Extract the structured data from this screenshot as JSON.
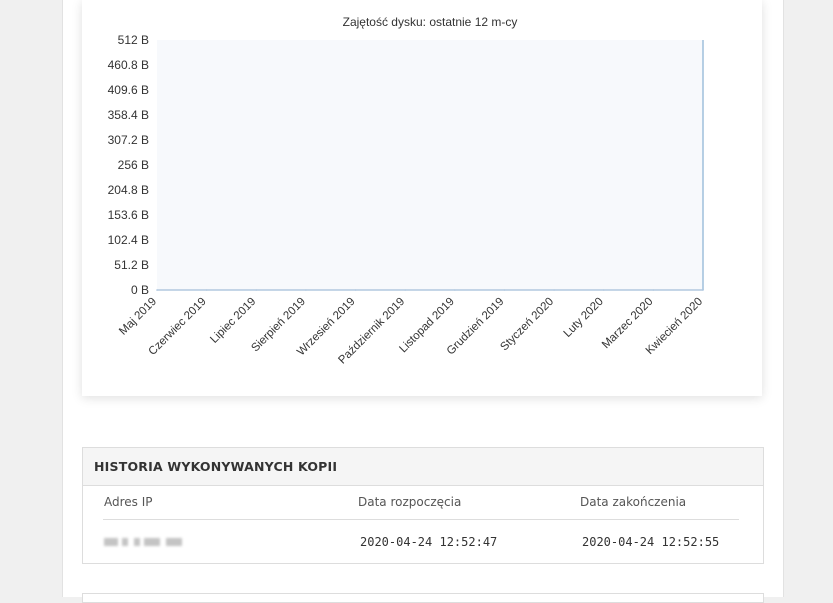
{
  "chart_data": {
    "type": "area",
    "title": "Zajętość dysku: ostatnie 12 m-cy",
    "xlabel": "",
    "ylabel": "",
    "categories": [
      "Maj 2019",
      "Czerwiec 2019",
      "Lipiec 2019",
      "Sierpień 2019",
      "Wrzesień 2019",
      "Październik 2019",
      "Listopad 2019",
      "Grudzień 2019",
      "Styczeń 2020",
      "Luty 2020",
      "Marzec 2020",
      "Kwiecień 2020"
    ],
    "series": [
      {
        "values": [
          0,
          0,
          0,
          0,
          0,
          0,
          0,
          0,
          0,
          0,
          0,
          0
        ],
        "color": "#a7c4de"
      }
    ],
    "yticks": [
      "0 B",
      "51.2 B",
      "102.4 B",
      "153.6 B",
      "204.8 B",
      "256 B",
      "307.2 B",
      "358.4 B",
      "409.6 B",
      "460.8 B",
      "512 B"
    ],
    "ylim": [
      0,
      512
    ],
    "grid": false,
    "plot_background": "#f7f9fc",
    "legend": "none"
  },
  "history": {
    "title": "HISTORIA WYKONYWANYCH KOPII",
    "columns": {
      "ip": "Adres IP",
      "start": "Data rozpoczęcia",
      "end": "Data zakończenia"
    },
    "rows": [
      {
        "start": "2020-04-24 12:52:47",
        "end": "2020-04-24 12:52:55"
      }
    ]
  }
}
